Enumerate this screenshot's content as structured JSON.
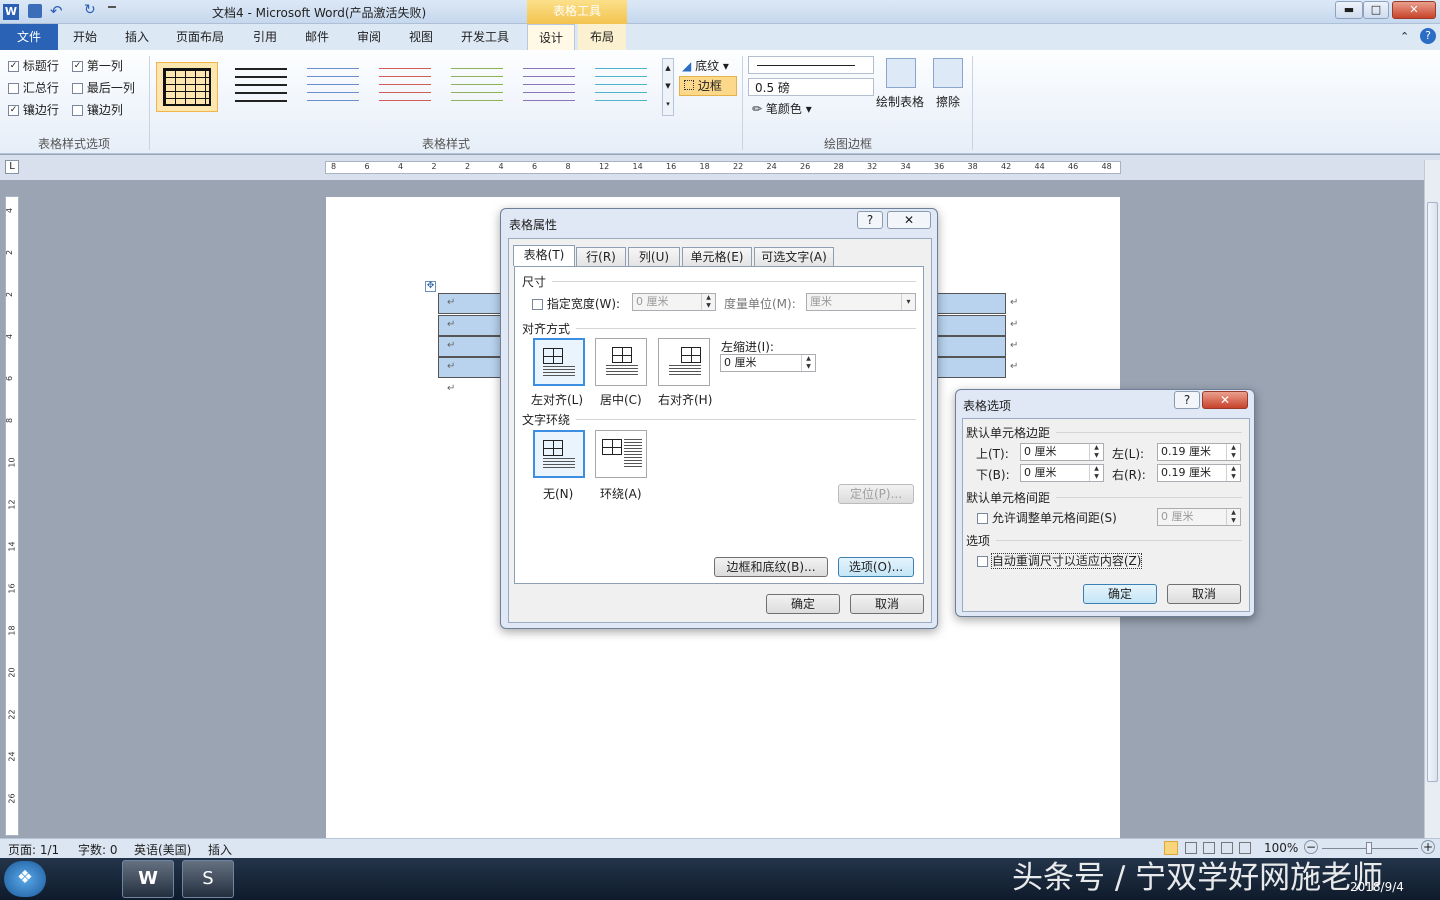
{
  "titlebar": {
    "title": "文档4 - Microsoft Word(产品激活失败)",
    "contextual_group": "表格工具",
    "minimize": "▬",
    "maximize": "□",
    "close": "✕",
    "word_icon": "W",
    "undo_glyph": "↶",
    "redo_glyph": "↻"
  },
  "tabs": {
    "file": "文件",
    "home": "开始",
    "insert": "插入",
    "page_layout": "页面布局",
    "references": "引用",
    "mailings": "邮件",
    "review": "审阅",
    "view": "视图",
    "developer": "开发工具",
    "design": "设计",
    "layout": "布局"
  },
  "ribbon": {
    "options": {
      "header_row": "标题行",
      "first_column": "第一列",
      "total_row": "汇总行",
      "last_column": "最后一列",
      "banded_rows": "镶边行",
      "banded_columns": "镶边列",
      "group_label": "表格样式选项"
    },
    "styles": {
      "group_label": "表格样式",
      "shading": "底纹",
      "borders": "边框"
    },
    "draw": {
      "weight": "0.5 磅",
      "pen_color": "笔颜色",
      "draw_table": "绘制表格",
      "eraser": "擦除",
      "group_label": "绘图边框"
    }
  },
  "ruler": {
    "h_ticks": [
      "8",
      "6",
      "4",
      "2",
      "2",
      "4",
      "6",
      "8",
      "12",
      "14",
      "16",
      "18",
      "22",
      "24",
      "26",
      "28",
      "32",
      "34",
      "36",
      "38",
      "42",
      "44",
      "46",
      "48"
    ],
    "v_ticks": [
      "4",
      "2",
      "2",
      "4",
      "6",
      "8",
      "10",
      "12",
      "14",
      "16",
      "18",
      "20",
      "22",
      "24",
      "26"
    ]
  },
  "table_properties": {
    "title": "表格属性",
    "help": "?",
    "close": "✕",
    "tabs": [
      "表格(T)",
      "行(R)",
      "列(U)",
      "单元格(E)",
      "可选文字(A)"
    ],
    "size_label": "尺寸",
    "preferred_width": "指定宽度(W):",
    "width_value": "0 厘米",
    "measure_in": "度量单位(M):",
    "measure_value": "厘米",
    "alignment_label": "对齐方式",
    "align_left": "左对齐(L)",
    "align_center": "居中(C)",
    "align_right": "右对齐(H)",
    "indent_label": "左缩进(I):",
    "indent_value": "0 厘米",
    "wrapping_label": "文字环绕",
    "wrap_none": "无(N)",
    "wrap_around": "环绕(A)",
    "positioning": "定位(P)...",
    "borders_shading": "边框和底纹(B)...",
    "options": "选项(O)...",
    "ok": "确定",
    "cancel": "取消"
  },
  "table_options": {
    "title": "表格选项",
    "help": "?",
    "close": "✕",
    "margins_label": "默认单元格边距",
    "top": "上(T):",
    "top_value": "0 厘米",
    "left": "左(L):",
    "left_value": "0.19 厘米",
    "bottom": "下(B):",
    "bottom_value": "0 厘米",
    "right": "右(R):",
    "right_value": "0.19 厘米",
    "spacing_label": "默认单元格间距",
    "allow_spacing": "允许调整单元格间距(S)",
    "spacing_value": "0 厘米",
    "options_label": "选项",
    "autoresize": "自动重调尺寸以适应内容(Z)",
    "ok": "确定",
    "cancel": "取消"
  },
  "statusbar": {
    "page": "页面: 1/1",
    "words": "字数: 0",
    "language": "英语(美国)",
    "mode": "插入",
    "zoom": "100%",
    "zoom_minus": "−",
    "zoom_plus": "+"
  },
  "taskbar": {
    "date": "2018/9/4",
    "time": "",
    "watermark": "头条号 / 宁双学好网施老师",
    "start_glyph": "❖",
    "word_glyph": "W",
    "sogou_glyph": "S"
  },
  "colors": {
    "accent": "#2a62b5",
    "contextual": "#f3c34e",
    "selection": "#b9d3ef"
  }
}
